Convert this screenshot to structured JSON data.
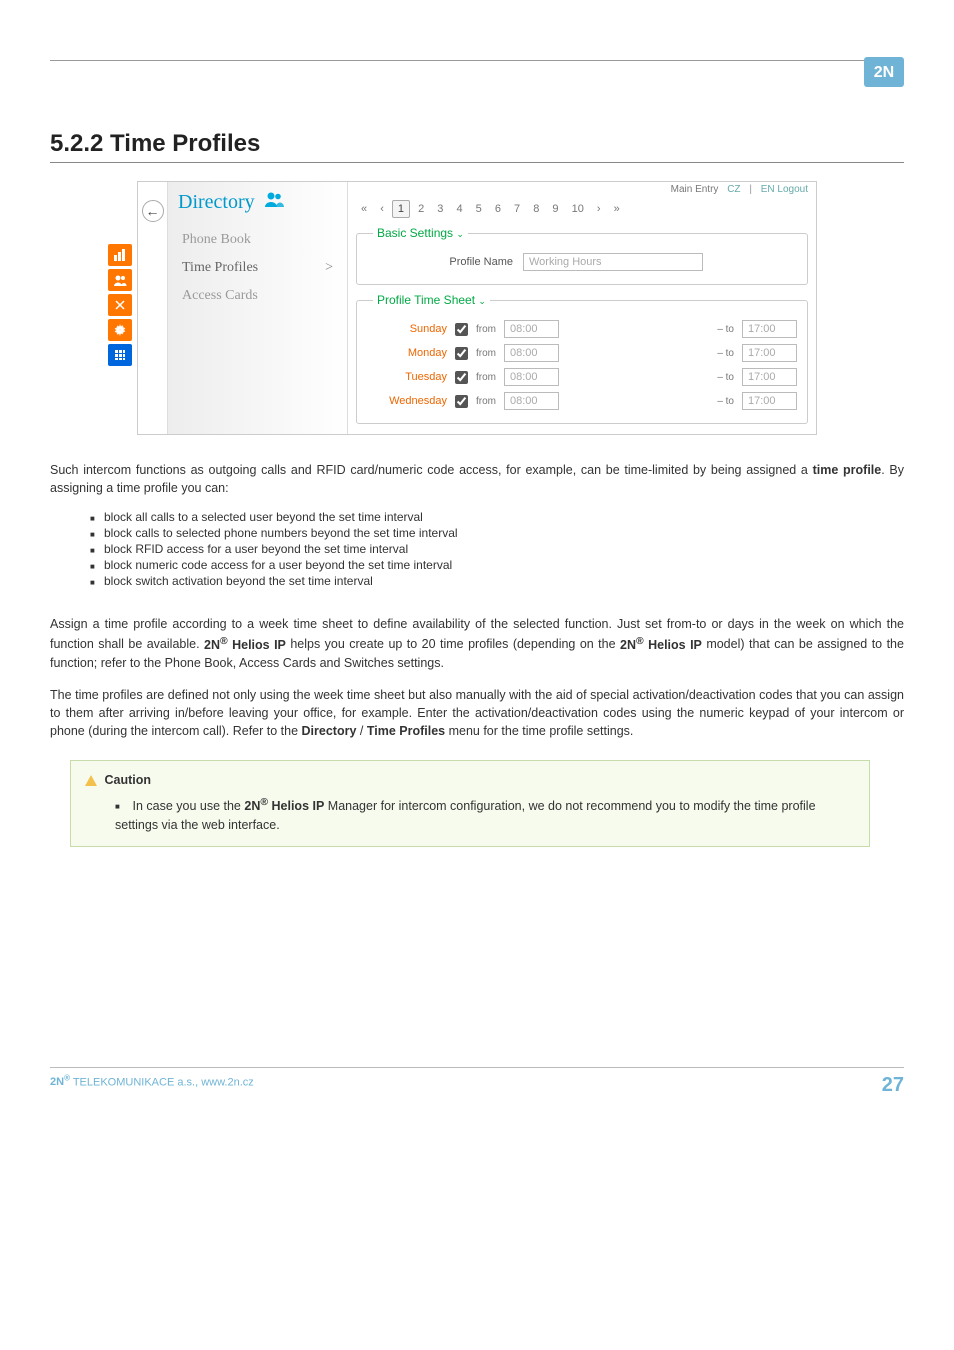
{
  "logo": {
    "brand": "2N"
  },
  "heading": "5.2.2 Time Profiles",
  "screenshot": {
    "backBtn": "←",
    "dirTitle": "Directory",
    "dirIconName": "group-icon",
    "nav": [
      {
        "label": "Phone Book",
        "active": false
      },
      {
        "label": "Time Profiles",
        "active": true,
        "caret": ">"
      },
      {
        "label": "Access Cards",
        "active": false
      }
    ],
    "topLinks": {
      "main": "Main Entry",
      "lang1": "CZ",
      "lang2": "EN",
      "logout": "Logout"
    },
    "pager": {
      "first": "«",
      "prev": "‹",
      "pages": [
        "1",
        "2",
        "3",
        "4",
        "5",
        "6",
        "7",
        "8",
        "9",
        "10"
      ],
      "next": "›",
      "last": "»",
      "current": "1"
    },
    "basic": {
      "legend": "Basic Settings",
      "profileNameLabel": "Profile Name",
      "profileNameValue": "Working Hours"
    },
    "sheet": {
      "legend": "Profile Time Sheet",
      "days": [
        {
          "name": "Sunday",
          "checked": true,
          "from": "08:00",
          "to": "17:00"
        },
        {
          "name": "Monday",
          "checked": true,
          "from": "08:00",
          "to": "17:00"
        },
        {
          "name": "Tuesday",
          "checked": true,
          "from": "08:00",
          "to": "17:00"
        },
        {
          "name": "Wednesday",
          "checked": true,
          "from": "08:00",
          "to": "17:00"
        }
      ],
      "fromLabel": "from",
      "toLabel": "– to"
    }
  },
  "body": {
    "p1a": "Such intercom functions as outgoing calls and RFID card/numeric code access, for example, can be time-limited by being assigned a ",
    "p1b": "time profile",
    "p1c": ". By assigning a time profile you can:",
    "bullets": [
      "block all calls to a selected user beyond the set time interval",
      "block calls to selected phone numbers beyond the set time interval",
      "block RFID access for a user beyond the set time interval",
      "block numeric code access for a user beyond the set time interval",
      "block switch activation beyond the set time interval"
    ],
    "p2a": "Assign a time profile according to a week time sheet to define availability of the selected function. Just set from-to or days in the week on which the function shall be available. ",
    "p2b": "2N",
    "p2c": " Helios IP",
    "p2d": " helps you create up to 20 time profiles (depending on the ",
    "p2e": "2N",
    "p2f": " Helios IP",
    "p2g": " model) that can be assigned to the function; refer to the Phone Book, Access Cards and Switches settings.",
    "p3a": "The time profiles are defined not only using the week time sheet but also manually with the aid of special activation/deactivation codes that you can assign to them after arriving in/before leaving your office, for example. Enter the activation/deactivation codes using the numeric keypad of your intercom or phone (during the intercom call). Refer to the ",
    "p3b": "Directory",
    "p3c": " / ",
    "p3d": "Time Profiles",
    "p3e": " menu for the time profile settings."
  },
  "caution": {
    "title": "Caution",
    "text1": "In case you use the ",
    "text2": "2N",
    "text3": " Helios IP",
    "text4": " Manager for intercom configuration, we do not recommend you to modify the time profile settings via the web interface."
  },
  "footer": {
    "left1": "2N",
    "left2": " TELEKOMUNIKACE a.s., www.2n.cz",
    "page": "27"
  }
}
